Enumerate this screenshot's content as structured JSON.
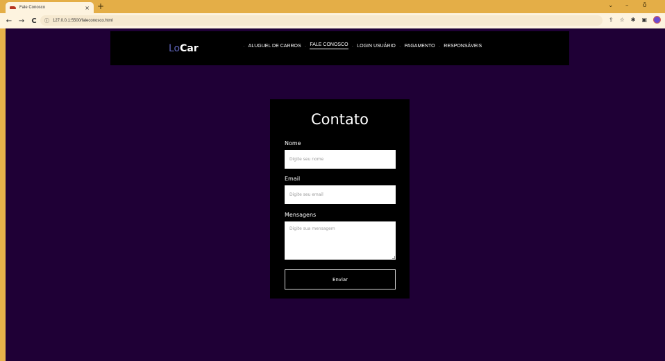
{
  "browser": {
    "tab_title": "Fale Conosco",
    "tab_close": "×",
    "new_tab": "+",
    "url": "127.0.0.1:5500/faleconosco.html",
    "info_icon": "ⓘ",
    "back": "←",
    "forward": "→",
    "reload": "C",
    "share": "⇪",
    "star": "☆",
    "extensions": "✱",
    "sidebar": "▣",
    "win_chevron": "⌄",
    "win_minimize": "–",
    "win_maximize": "ō"
  },
  "navbar": {
    "logo_prefix": "Lo",
    "logo_suffix": "Car",
    "links": [
      {
        "label": "ALUGUEL DE CARROS"
      },
      {
        "label": "FALE CONOSCO"
      },
      {
        "label": "LOGIN USUÁRIO"
      },
      {
        "label": "PAGAMENTO"
      },
      {
        "label": "RESPONSÁVEIS"
      }
    ],
    "separator": "·"
  },
  "form": {
    "title": "Contato",
    "name_label": "Nome",
    "name_placeholder": "Digite seu nome",
    "email_label": "Email",
    "email_placeholder": "Digite seu email",
    "message_label": "Mensagens",
    "message_placeholder": "Digite sua mensagem",
    "submit_label": "Enviar"
  },
  "colors": {
    "page_background": "#1f0036",
    "navbar_background": "#000000",
    "logo_accent": "#5d63b8",
    "browser_frame": "#e4ae47"
  }
}
